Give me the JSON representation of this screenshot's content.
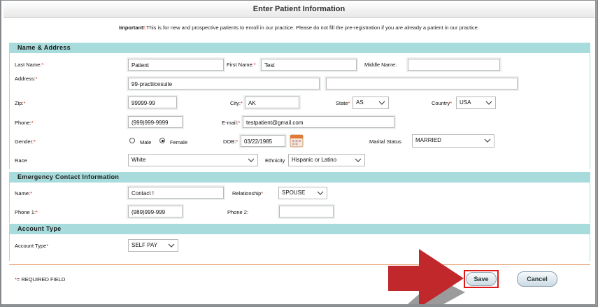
{
  "title": "Enter Patient Information",
  "important": {
    "label": "Important",
    "mark": "!",
    "text": ":This is for new and prospective patients to enroll in our practice. Please do not fill the pre-registration if you are already a patient in our practice."
  },
  "sections": {
    "name_address": "Name & Address",
    "emergency": "Emergency Contact Information",
    "account": "Account Type"
  },
  "labels": {
    "last_name": "Last Name:",
    "first_name": "First Name:",
    "middle_name": "Middle Name:",
    "address": "Address:",
    "zip": "Zip:",
    "city": "City:",
    "state": "State",
    "country": "Country",
    "phone": "Phone:",
    "email": "E-mail:",
    "gender": "Gender:",
    "male": "Male",
    "female": "Female",
    "dob": "DOB:",
    "marital": "Marital Status",
    "race": "Race",
    "ethnicity": "Ethnicity",
    "ec_name": "Name:",
    "relationship": "Relationship",
    "phone1": "Phone 1:",
    "phone2": "Phone 2:",
    "account_type": "Account Type",
    "required_mark": "*",
    "required_note": "= REQUIRED FIELD"
  },
  "values": {
    "last_name": "Patient",
    "first_name": "Test",
    "middle_name": "",
    "address1": "99-practiicesuite",
    "address2": "",
    "zip": "99999-99",
    "city": "AK",
    "state": "AS",
    "country": "USA",
    "phone": "(999)999-9999",
    "email": "testpatient@gmail.com",
    "gender": "Female",
    "dob": "03/22/1985",
    "marital": "MARRIED",
    "race": "White",
    "ethnicity": "Hispanic or Latino",
    "ec_name": "Contact !",
    "relationship": "SPOUSE",
    "phone1": "(989)999-999",
    "phone2": "",
    "account_type": "SELF PAY"
  },
  "buttons": {
    "save": "Save",
    "cancel": "Cancel"
  },
  "colors": {
    "section_bg": "#a8dcdc",
    "required": "#dd2211",
    "highlight": "#e01818",
    "arrow": "#c0282c"
  }
}
